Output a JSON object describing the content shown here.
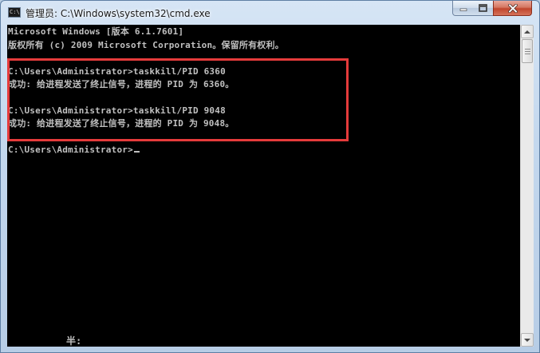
{
  "window": {
    "title": "管理员: C:\\Windows\\system32\\cmd.exe",
    "icon_label": "C:\\"
  },
  "console": {
    "lines": [
      "Microsoft Windows [版本 6.1.7601]",
      "版权所有 (c) 2009 Microsoft Corporation。保留所有权利。",
      "",
      "C:\\Users\\Administrator>taskkill/PID 6360",
      "成功: 给进程发送了终止信号，进程的 PID 为 6360。",
      "",
      "C:\\Users\\Administrator>taskkill/PID 9048",
      "成功: 给进程发送了终止信号，进程的 PID 为 9048。",
      "",
      "C:\\Users\\Administrator>"
    ],
    "ime_status": "半:"
  },
  "colors": {
    "console_bg": "#000000",
    "console_text": "#c0c0c0",
    "highlight_border": "#e53b3b",
    "close_button": "#c0452c"
  },
  "icons": {
    "app": "console-icon",
    "minimize": "minimize-icon",
    "maximize": "maximize-icon",
    "close": "close-icon",
    "scroll_up": "chevron-up-icon",
    "scroll_down": "chevron-down-icon"
  }
}
